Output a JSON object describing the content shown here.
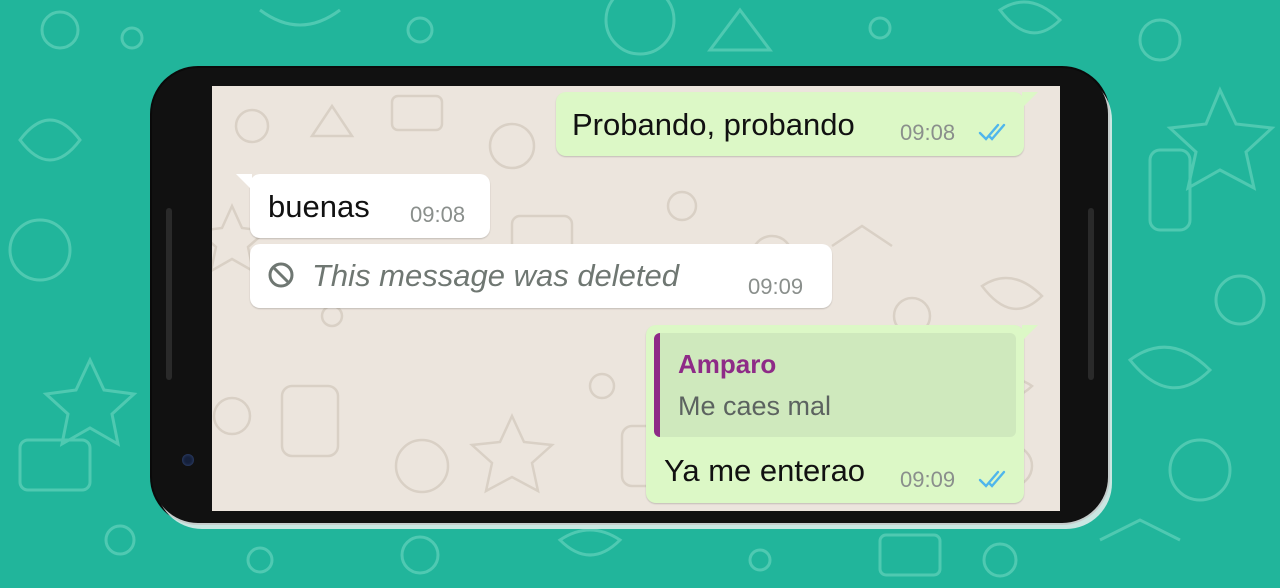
{
  "colors": {
    "background": "#21b59b",
    "chat_wallpaper": "#ece5dd",
    "outgoing_bubble": "#dcf8c6",
    "incoming_bubble": "#ffffff",
    "quote_author": "#8e2b87",
    "read_ticks": "#4fb6ec"
  },
  "messages": [
    {
      "direction": "outgoing",
      "text": "Probando, probando",
      "time": "09:08",
      "status_icon": "double-check-icon"
    },
    {
      "direction": "incoming",
      "text": "buenas",
      "time": "09:08"
    },
    {
      "direction": "incoming",
      "deleted": true,
      "icon": "blocked-icon",
      "text": "This message was deleted",
      "time": "09:09"
    },
    {
      "direction": "outgoing",
      "quoted": {
        "author": "Amparo",
        "text": "Me caes mal"
      },
      "text": "Ya me enterao",
      "time": "09:09",
      "status_icon": "double-check-icon"
    }
  ]
}
